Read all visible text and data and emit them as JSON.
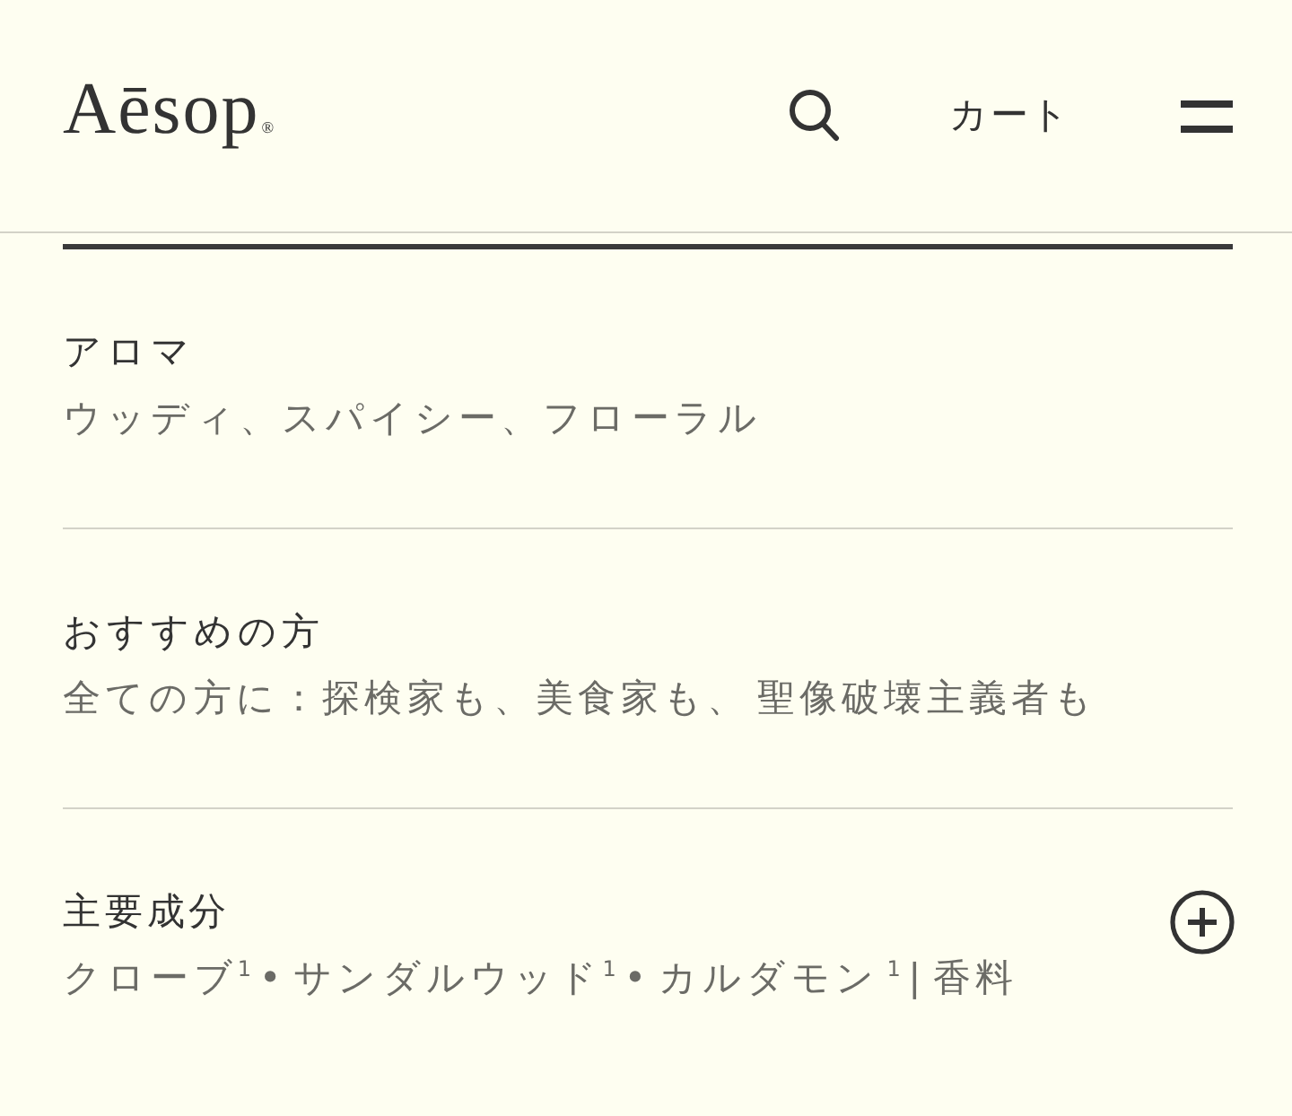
{
  "header": {
    "logo": "Aēsop$_{®}$",
    "cart": "カート"
  },
  "sections": [
    {
      "title": "アロマ",
      "value": "ウッディ、スパイシー、フローラル"
    },
    {
      "title": "おすすめの方",
      "value": "全ての方に：探検家も、美食家も、 聖像破壊主義者も"
    },
    {
      "title": "主要成分",
      "value": "クローブ$^{1}$ • サンダルウッド$^{1}$ • カルダモン $^{1}$ | 香料",
      "expanded": false
    }
  ]
}
